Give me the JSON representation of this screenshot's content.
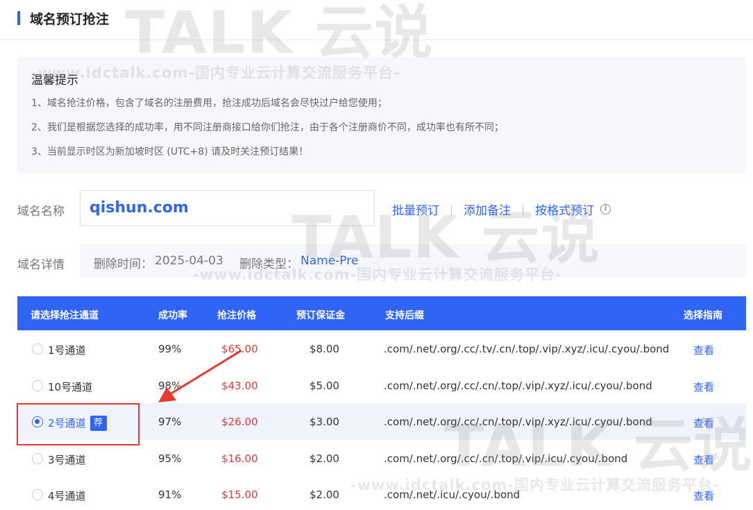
{
  "page": {
    "title": "域名预订抢注"
  },
  "notice": {
    "title": "温馨提示",
    "lines": [
      "1、域名抢注价格，包含了域名的注册费用，抢注成功后域名会尽快过户给您使用；",
      "2、我们是根据您选择的成功率，用不同注册商接口给你们抢注，由于各个注册商价不同，成功率也有所不同；",
      "3、当前显示时区为新加坡时区 (UTC+8) 请及时关注预订结果！"
    ]
  },
  "domain": {
    "label": "域名名称",
    "value": "qishun.com",
    "links": [
      "批量预订",
      "添加备注",
      "按格式预订"
    ],
    "info_icon": "info-circle-icon"
  },
  "detail": {
    "label": "域名详情",
    "delete_time_label": "删除时间：",
    "delete_time": "2025-04-03",
    "delete_type_label": "删除类型：",
    "delete_type": "Name-Pre"
  },
  "table": {
    "headers": [
      "请选择抢注通道",
      "成功率",
      "抢注价格",
      "预订保证金",
      "支持后缀",
      "选择指南"
    ],
    "rows": [
      {
        "channel": "1号通道",
        "rate": "99%",
        "price": "$65.00",
        "deposit": "$8.00",
        "suffix": ".com/.net/.org/.cc/.tv/.cn/.top/.vip/.xyz/.icu/.cyou/.bond",
        "guide": "查看",
        "selected": false,
        "tag": ""
      },
      {
        "channel": "10号通道",
        "rate": "98%",
        "price": "$43.00",
        "deposit": "$5.00",
        "suffix": ".com/.net/.org/.cc/.cn/.top/.vip/.xyz/.icu/.cyou/.bond",
        "guide": "查看",
        "selected": false,
        "tag": ""
      },
      {
        "channel": "2号通道",
        "rate": "97%",
        "price": "$26.00",
        "deposit": "$3.00",
        "suffix": ".com/.net/.org/.cc/.cn/.top/.vip/.xyz/.icu/.cyou/.bond",
        "guide": "查看",
        "selected": true,
        "tag": "荐"
      },
      {
        "channel": "3号通道",
        "rate": "95%",
        "price": "$16.00",
        "deposit": "$2.00",
        "suffix": ".com/.net/.org/.cc/.cn/.top/.vip/.icu/.cyou/.bond",
        "guide": "查看",
        "selected": false,
        "tag": ""
      },
      {
        "channel": "4号通道",
        "rate": "91%",
        "price": "$15.00",
        "deposit": "$2.00",
        "suffix": ".com/.net/.icu/.cyou/.bond",
        "guide": "查看",
        "selected": false,
        "tag": ""
      }
    ]
  },
  "watermark": {
    "logo": "TALK 云说",
    "url": "-www.idctalk.com-国内专业云计算交流服务平台-"
  },
  "colors": {
    "accent": "#2f64f5",
    "price": "#e4393c",
    "highlight": "#e8392f"
  }
}
